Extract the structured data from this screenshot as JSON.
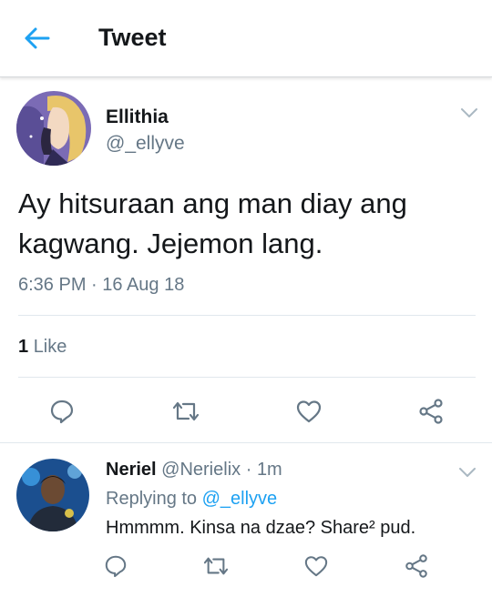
{
  "header": {
    "title": "Tweet"
  },
  "tweet": {
    "author_name": "Ellithia",
    "author_handle": "@_ellyve",
    "text_line1": "Ay hitsuraan ang man diay ang",
    "text_line2": "kagwang. Jejemon lang.",
    "timestamp": "6:36 PM · 16 Aug 18",
    "like_count": "1",
    "like_label": "Like"
  },
  "reply": {
    "author_name": "Neriel",
    "author_handle": "@Nerielix",
    "separator": "·",
    "time_ago": "1m",
    "replying_prefix": "Replying to",
    "replying_to": "@_ellyve",
    "text": "Hmmmm. Kinsa na dzae? Share² pud."
  },
  "icons": [
    "back-arrow-icon",
    "chevron-down-icon",
    "reply-icon",
    "retweet-icon",
    "like-icon",
    "share-icon"
  ],
  "colors": {
    "accent": "#1da1f2",
    "secondary_text": "#657786",
    "icon_gray": "#657786"
  }
}
